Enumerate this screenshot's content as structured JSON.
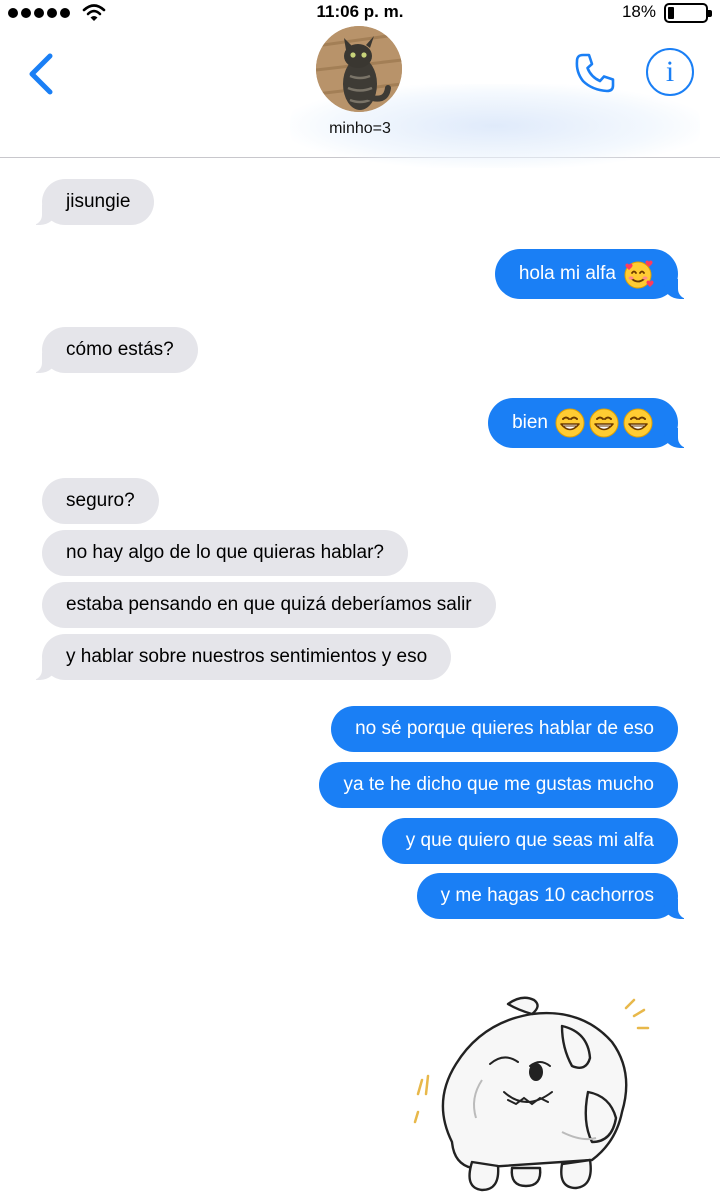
{
  "status_bar": {
    "time": "11:06 p. m.",
    "battery_percent": "18%",
    "battery_level": 0.18,
    "signal_bars": 5,
    "wifi_icon": "wifi-icon"
  },
  "header": {
    "contact_name": "minho=3",
    "back_icon": "chevron-left-icon",
    "call_icon": "phone-icon",
    "info_icon": "info-icon",
    "info_glyph": "i",
    "accent_color": "#1a7ff5"
  },
  "messages": [
    {
      "from": "them",
      "text": "jisungie"
    },
    {
      "from": "me",
      "text": "hola mi alfa",
      "emoji": [
        "smiling-face-with-hearts"
      ]
    },
    {
      "from": "them",
      "text": "cómo estás?"
    },
    {
      "from": "me",
      "text": "bien",
      "emoji": [
        "grinning-face",
        "grinning-face",
        "grinning-face"
      ]
    },
    {
      "from": "them",
      "text": "seguro?"
    },
    {
      "from": "them",
      "text": "no hay algo de lo que quieras hablar?"
    },
    {
      "from": "them",
      "text": "estaba pensando en que quizá deberíamos salir"
    },
    {
      "from": "them",
      "text": "y hablar sobre nuestros sentimientos y eso"
    },
    {
      "from": "me",
      "text": "no sé porque quieres hablar de eso"
    },
    {
      "from": "me",
      "text": "ya te he dicho que me gustas mucho"
    },
    {
      "from": "me",
      "text": "y que quiero que seas mi alfa"
    },
    {
      "from": "me",
      "text": "y me hagas 10 cachorros"
    }
  ],
  "sticker": {
    "icon": "white-creature-sticker"
  },
  "colors": {
    "incoming_bubble": "#e5e5ea",
    "outgoing_bubble": "#1a7ff5"
  }
}
